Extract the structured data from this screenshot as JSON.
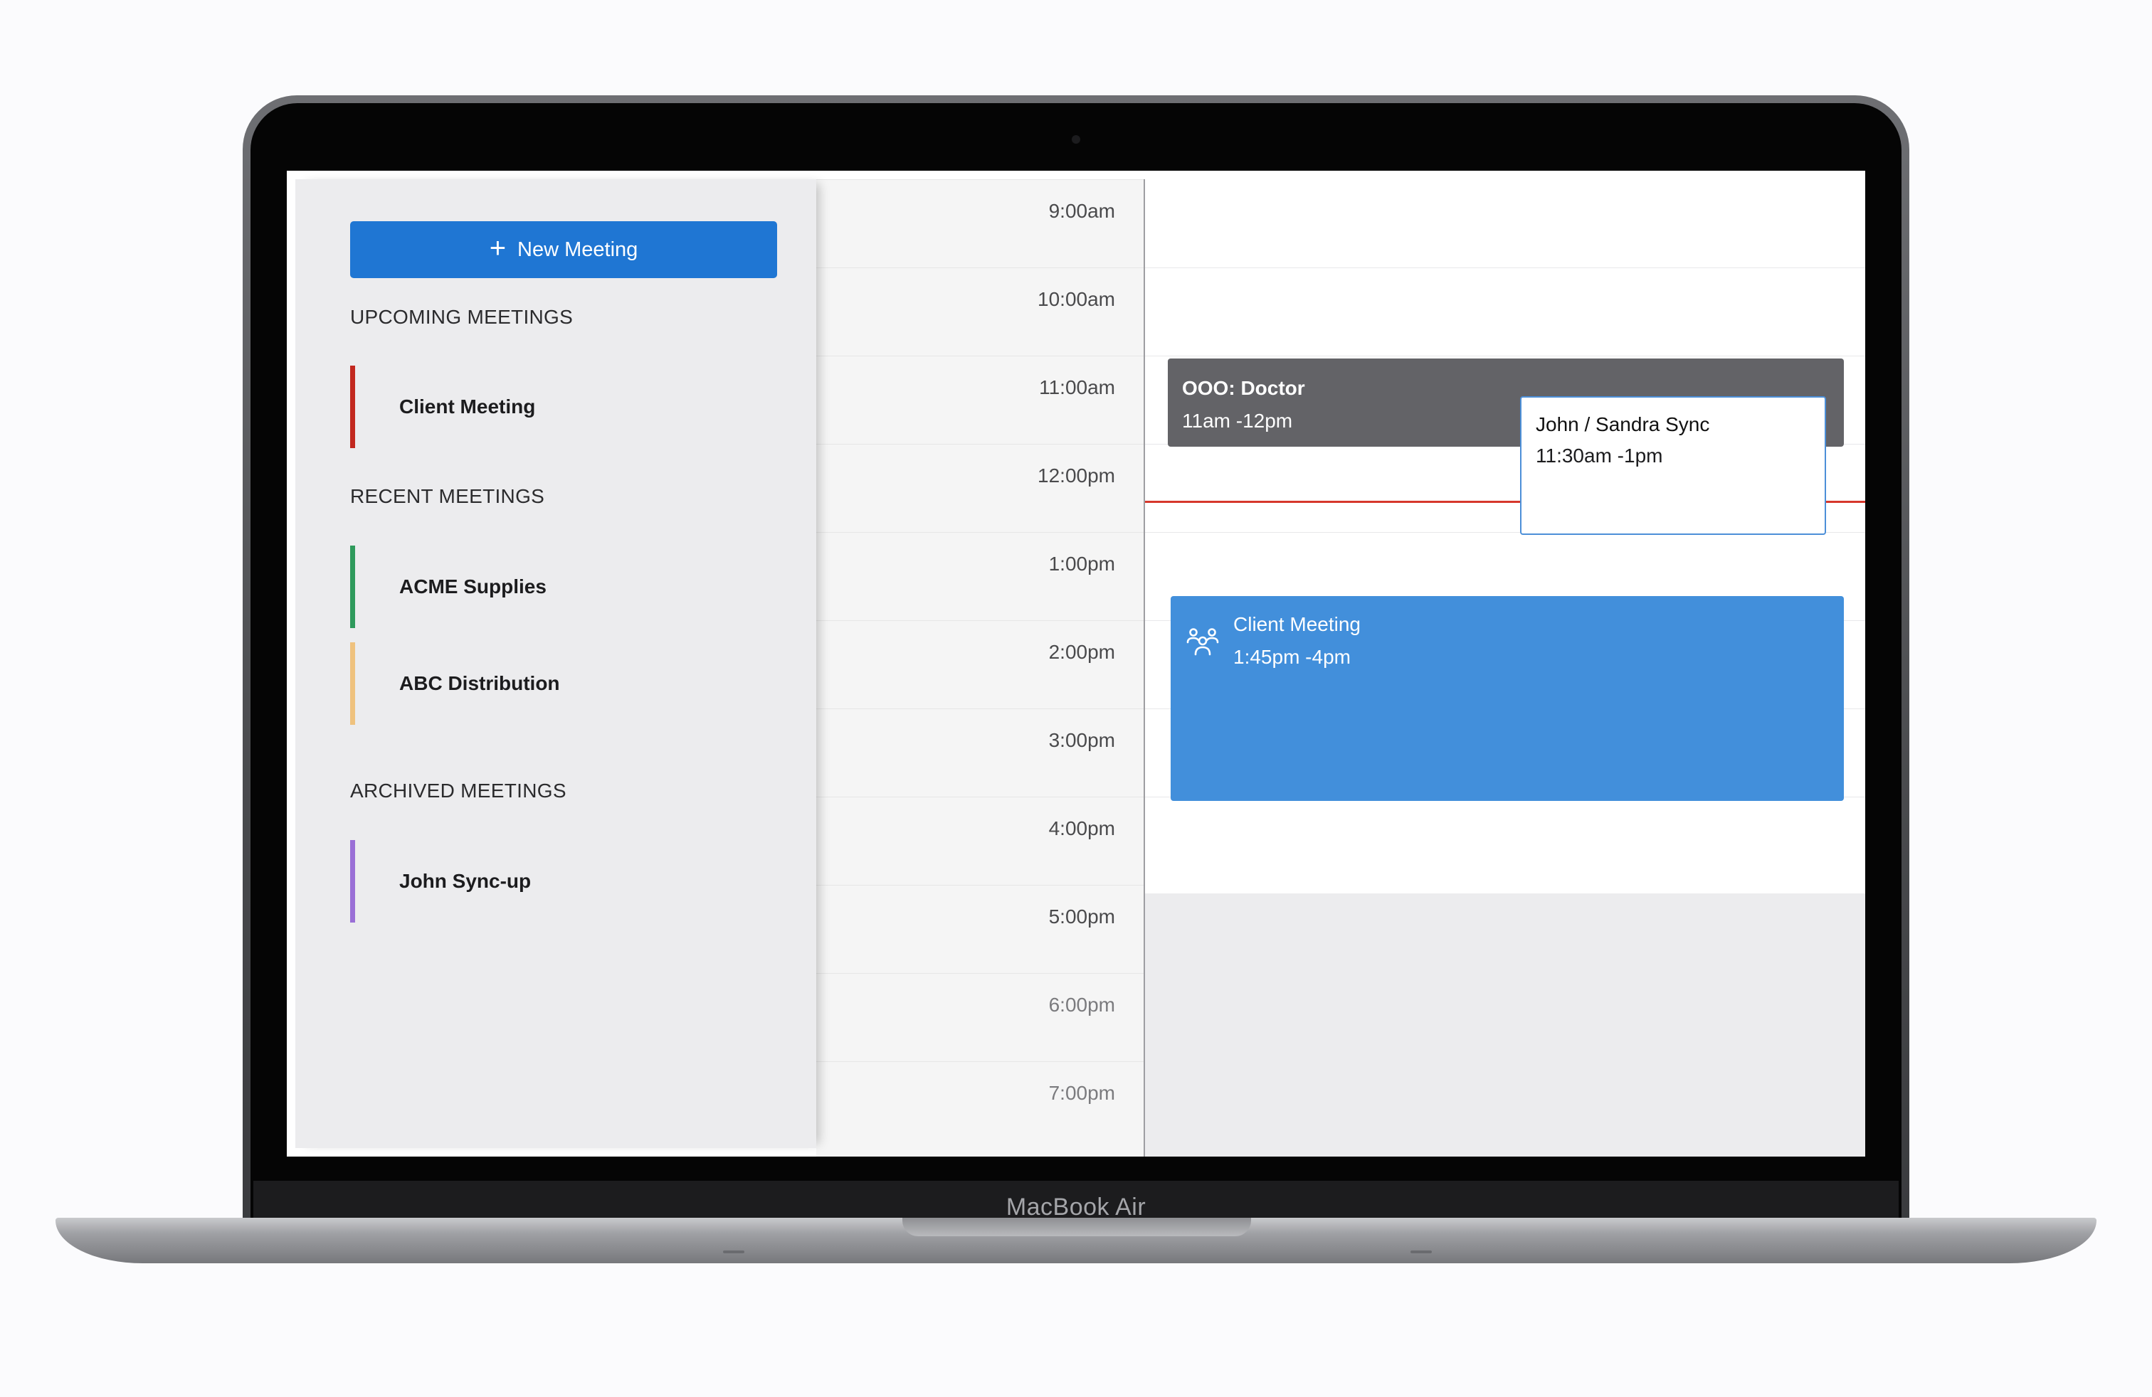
{
  "device": {
    "label": "MacBook Air"
  },
  "sidebar": {
    "new_meeting_label": "New Meeting",
    "sections": [
      {
        "title": "UPCOMING MEETINGS",
        "items": [
          {
            "label": "Client Meeting",
            "color": "#c2281f"
          }
        ]
      },
      {
        "title": "RECENT MEETINGS",
        "items": [
          {
            "label": "ACME Supplies",
            "color": "#2f9a5c"
          },
          {
            "label": "ABC Distribution",
            "color": "#efc27e"
          }
        ]
      },
      {
        "title": "ARCHIVED MEETINGS",
        "items": [
          {
            "label": "John Sync-up",
            "color": "#9a6fd6"
          }
        ]
      }
    ]
  },
  "calendar": {
    "times": [
      "9:00am",
      "10:00am",
      "11:00am",
      "12:00pm",
      "1:00pm",
      "2:00pm",
      "3:00pm",
      "4:00pm",
      "5:00pm",
      "6:00pm",
      "7:00pm"
    ],
    "events": [
      {
        "title": "OOO: Doctor",
        "time": "11am -12pm"
      },
      {
        "title": "John / Sandra Sync",
        "time": "11:30am -1pm"
      },
      {
        "title": "Client Meeting",
        "time": "1:45pm -4pm",
        "icon": "group-icon"
      }
    ]
  },
  "colors": {
    "accent": "#1f76d3",
    "event_blue": "#428fdb",
    "event_gray": "#636367",
    "current_time_line": "#d6372c"
  }
}
